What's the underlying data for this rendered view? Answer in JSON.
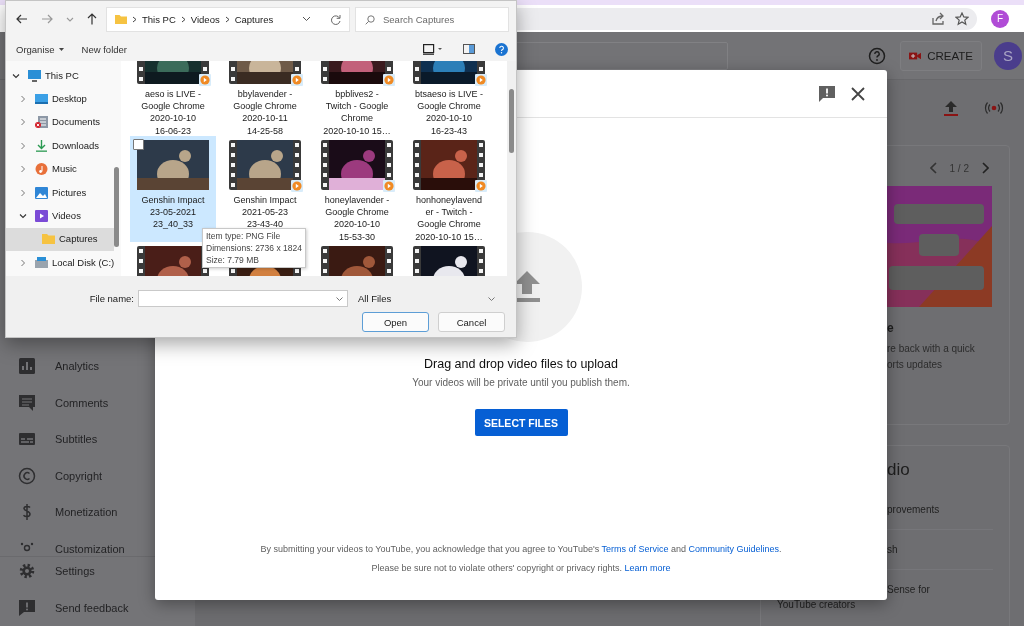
{
  "browser": {
    "profile_initial": "F"
  },
  "studio": {
    "header": {
      "create_label": "CREATE",
      "avatar_initial": "S"
    },
    "sidebar": {
      "items": [
        {
          "label": "Analytics"
        },
        {
          "label": "Comments"
        },
        {
          "label": "Subtitles"
        },
        {
          "label": "Copyright"
        },
        {
          "label": "Monetization"
        },
        {
          "label": "Customization"
        }
      ],
      "footer_items": [
        {
          "label": "Settings"
        },
        {
          "label": "Send feedback"
        }
      ]
    },
    "news_card": {
      "pager": "1 / 2",
      "title": "e",
      "description_lines": [
        "re back with a quick",
        "orts updates"
      ]
    },
    "tips_card": {
      "title": "dio",
      "items": [
        {
          "lines": [
            "provements"
          ]
        },
        {
          "lines": [
            "sh"
          ]
        },
        {
          "lines": [
            "Sense for",
            "YouTube creators"
          ]
        }
      ]
    }
  },
  "upload_dialog": {
    "heading": "Drag and drop video files to upload",
    "subheading": "Your videos will be private until you publish them.",
    "button": "SELECT FILES",
    "terms": [
      {
        "kind": "text",
        "text": "By submitting your videos to YouTube, you acknowledge that you agree to YouTube's "
      },
      {
        "kind": "link",
        "text": "Terms of Service"
      },
      {
        "kind": "text",
        "text": " and "
      },
      {
        "kind": "link",
        "text": "Community Guidelines"
      },
      {
        "kind": "text",
        "text": "."
      }
    ],
    "notice": [
      {
        "kind": "text",
        "text": "Please be sure not to violate others' copyright or privacy rights. "
      },
      {
        "kind": "link",
        "text": "Learn more"
      }
    ]
  },
  "file_dialog": {
    "breadcrumb": [
      "This PC",
      "Videos",
      "Captures"
    ],
    "search_placeholder": "Search Captures",
    "toolbar": [
      "Organise",
      "New folder"
    ],
    "tree": [
      {
        "label": "This PC",
        "expanded": true,
        "selected": false,
        "children": [
          {
            "label": "Desktop",
            "expanded": false,
            "selected": false
          },
          {
            "label": "Documents",
            "expanded": false,
            "selected": false
          },
          {
            "label": "Downloads",
            "expanded": false,
            "selected": false
          },
          {
            "label": "Music",
            "expanded": false,
            "selected": false
          },
          {
            "label": "Pictures",
            "expanded": false,
            "selected": false
          },
          {
            "label": "Videos",
            "expanded": true,
            "selected": false,
            "children": [
              {
                "label": "Captures",
                "selected": true
              }
            ]
          },
          {
            "label": "Local Disk (C:)",
            "expanded": false,
            "selected": false
          }
        ]
      }
    ],
    "files": [
      {
        "kind": "video",
        "selected": false,
        "name_lines": [
          "aeso is LIVE -",
          "Google Chrome",
          "2020-10-10",
          "16-06-23"
        ]
      },
      {
        "kind": "video",
        "selected": false,
        "name_lines": [
          "bbylavender -",
          "Google Chrome",
          "2020-10-11",
          "14-25-58"
        ]
      },
      {
        "kind": "video",
        "selected": false,
        "name_lines": [
          "bpblives2 -",
          "Twitch - Google",
          "Chrome",
          "2020-10-10 15…"
        ]
      },
      {
        "kind": "video",
        "selected": false,
        "name_lines": [
          "btsaeso is LIVE -",
          "Google Chrome",
          "2020-10-10",
          "16-23-43"
        ]
      },
      {
        "selected": true,
        "name_lines": [
          "Genshin Impact",
          "23-05-2021",
          "23_40_33"
        ]
      },
      {
        "kind": "video",
        "selected": false,
        "name_lines": [
          "Genshin Impact",
          "2021-05-23",
          "23-43-40"
        ]
      },
      {
        "kind": "video",
        "selected": false,
        "name_lines": [
          "honeylavender -",
          "Google Chrome",
          "2020-10-10",
          "15-53-30"
        ]
      },
      {
        "kind": "video",
        "selected": false,
        "name_lines": [
          "honhoneylavend",
          "er - Twitch -",
          "Google Chrome",
          "2020-10-10 15…"
        ]
      },
      {
        "kind": "video",
        "selected": false
      },
      {
        "kind": "video",
        "selected": false
      },
      {
        "kind": "video",
        "selected": false
      },
      {
        "kind": "video",
        "selected": false
      }
    ],
    "tooltip": [
      "Item type: PNG File",
      "Dimensions: 2736 x 1824",
      "Size: 7.79 MB"
    ],
    "file_name_label": "File name:",
    "file_type": "All Files",
    "buttons": [
      {
        "label": "Open",
        "default": true
      },
      {
        "label": "Cancel",
        "default": false
      }
    ]
  }
}
